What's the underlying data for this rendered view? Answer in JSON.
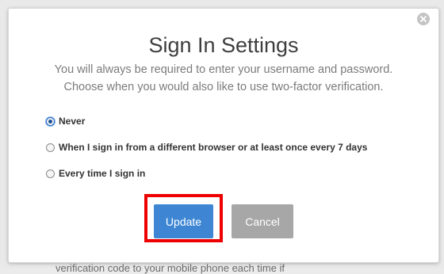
{
  "background_partial_text": "verification code to your mobile phone each time if",
  "dialog": {
    "title": "Sign In Settings",
    "description_line1": "You will always be required to enter your username and password.",
    "description_line2": "Choose when you would also like to use two-factor verification.",
    "close_icon": "close-icon",
    "options": [
      {
        "label": "Never",
        "selected": true
      },
      {
        "label": "When I sign in from a different browser or at least once every 7 days",
        "selected": false
      },
      {
        "label": "Every time I sign in",
        "selected": false
      }
    ],
    "buttons": {
      "update_label": "Update",
      "cancel_label": "Cancel"
    },
    "highlight_color": "#ee0000",
    "update_color": "#3e86d4",
    "cancel_color": "#a7a7a7"
  }
}
